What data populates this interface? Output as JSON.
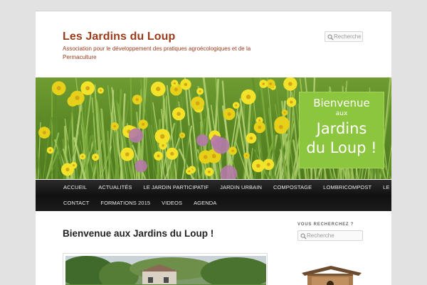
{
  "header": {
    "site_title": "Les Jardins du Loup",
    "site_description": "Association pour le développement des pratiques agroécologiques et de la Permaculture",
    "search_placeholder": "Recherche"
  },
  "banner": {
    "sign_line1": "Bienvenue",
    "sign_line2": "aux",
    "sign_line3": "Jardins",
    "sign_line4": "du Loup !"
  },
  "nav": {
    "row1": [
      "ACCUEIL",
      "ACTUALITÉS",
      "LE JARDIN PARTICIPATIF",
      "JARDIN URBAIN",
      "COMPOSTAGE",
      "LOMBRICOMPOST",
      "LE LIEU"
    ],
    "row2": [
      "CONTACT",
      "FORMATIONS 2015",
      "VIDEOS",
      "AGENDA"
    ]
  },
  "main": {
    "post_title": "Bienvenue aux Jardins du Loup !"
  },
  "sidebar": {
    "widget_title": "VOUS RECHERCHEZ ?",
    "search_placeholder": "Recherche"
  },
  "colors": {
    "page_background": "#e2e2e2",
    "title_color": "#9a3b1b",
    "nav_background": "#111111",
    "sign_green": "#8cc63f"
  },
  "icons": [
    "search-icon"
  ]
}
